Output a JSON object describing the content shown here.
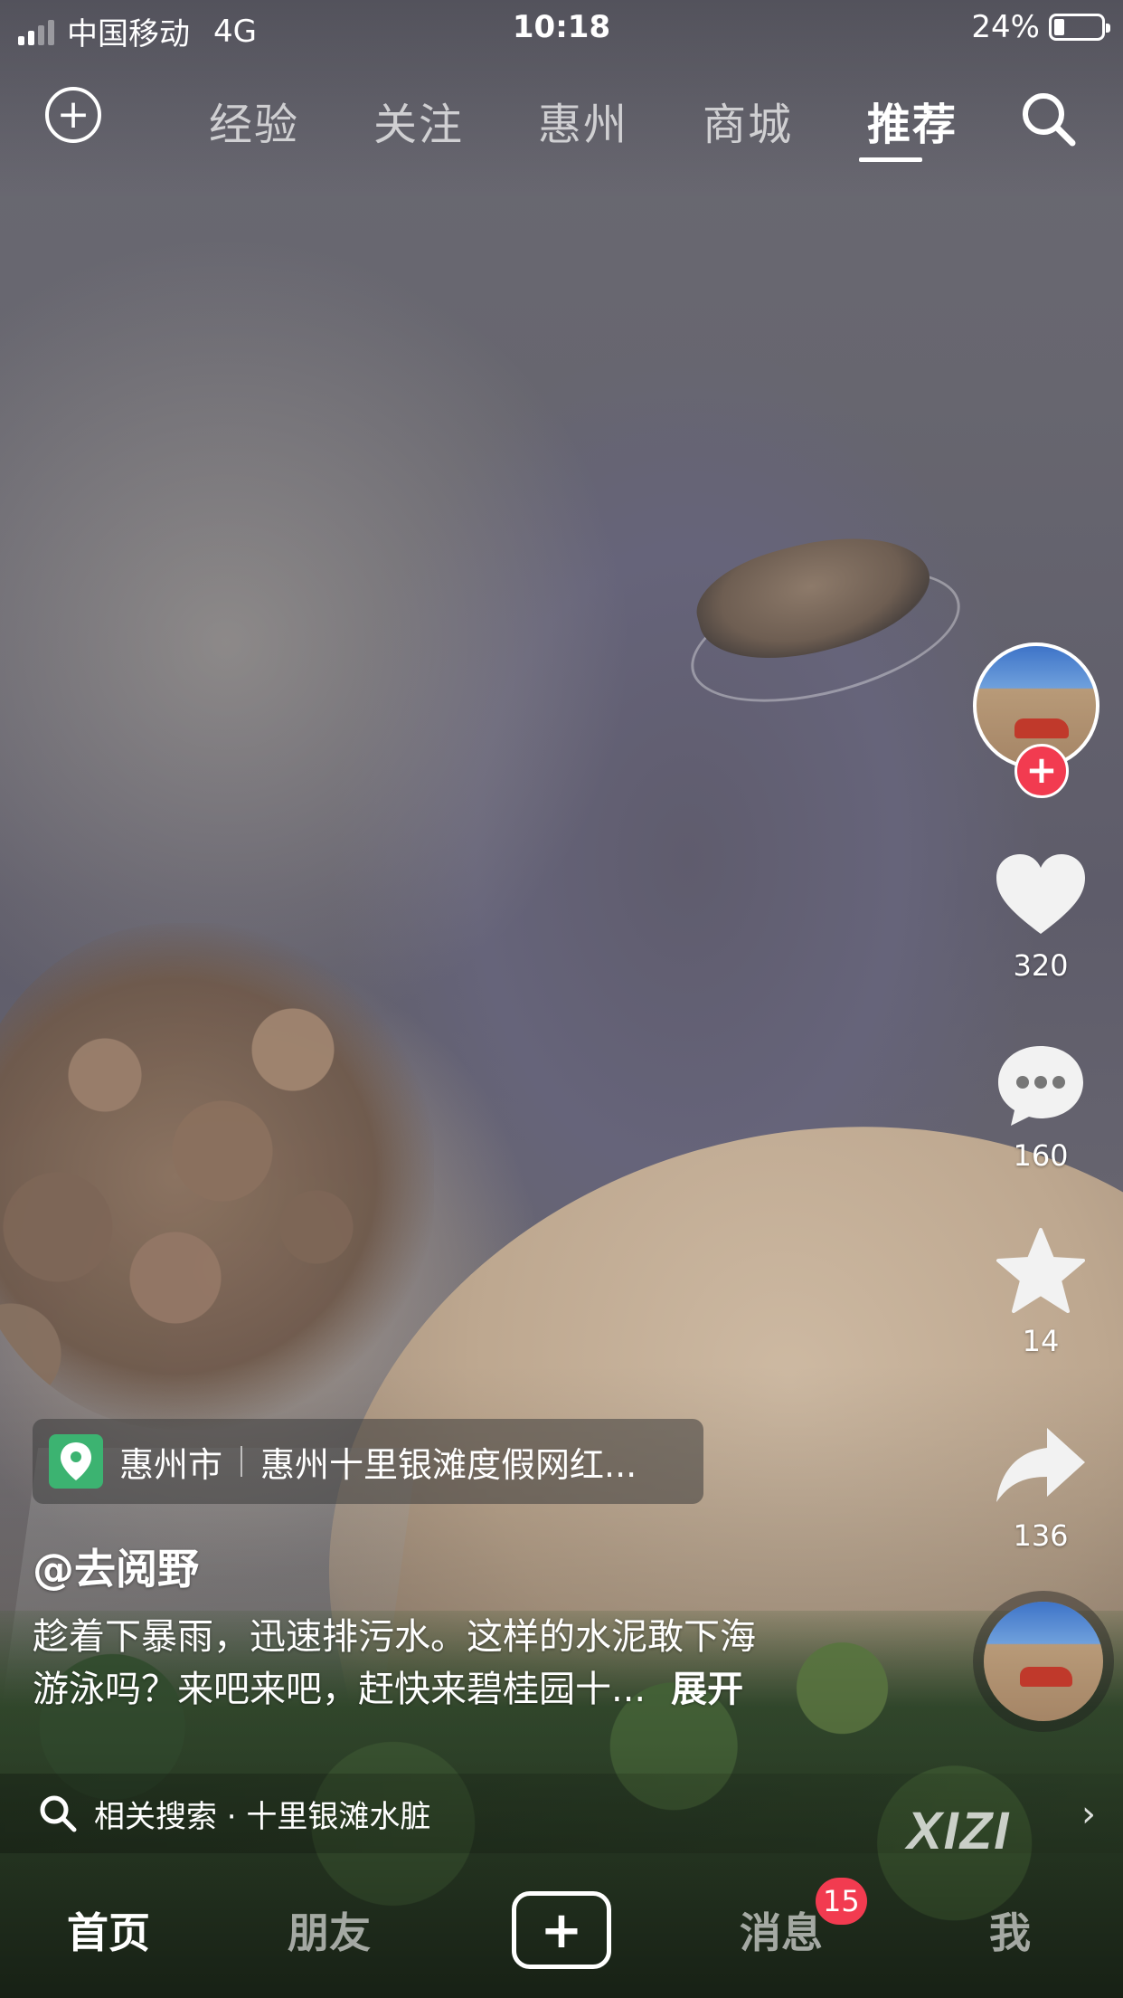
{
  "status_bar": {
    "carrier": "中国移动",
    "network": "4G",
    "time": "10:18",
    "battery": "24%"
  },
  "top_nav": {
    "tabs": [
      {
        "label": "经验"
      },
      {
        "label": "关注"
      },
      {
        "label": "惠州"
      },
      {
        "label": "商城"
      },
      {
        "label": "推荐"
      }
    ],
    "active_tab": "推荐"
  },
  "actions": {
    "likes": "320",
    "comments": "160",
    "favorites": "14",
    "shares": "136"
  },
  "location": {
    "city": "惠州市",
    "place": "惠州十里银滩度假网红..."
  },
  "post": {
    "author": "@去阅野",
    "caption_line1": "趁着下暴雨，迅速排污水。这样的水泥敢下海",
    "caption_line2": "游泳吗？来吧来吧，赶快来碧桂园十...",
    "expand_label": "展开"
  },
  "related_search": {
    "text": "相关搜索 · 十里银滩水脏"
  },
  "watermark": "XIZI",
  "bottom_bar": {
    "home": "首页",
    "friends": "朋友",
    "inbox": "消息",
    "inbox_badge": "15",
    "me": "我"
  },
  "colors": {
    "accent": "#f23b50",
    "location_icon": "#3cb371"
  }
}
